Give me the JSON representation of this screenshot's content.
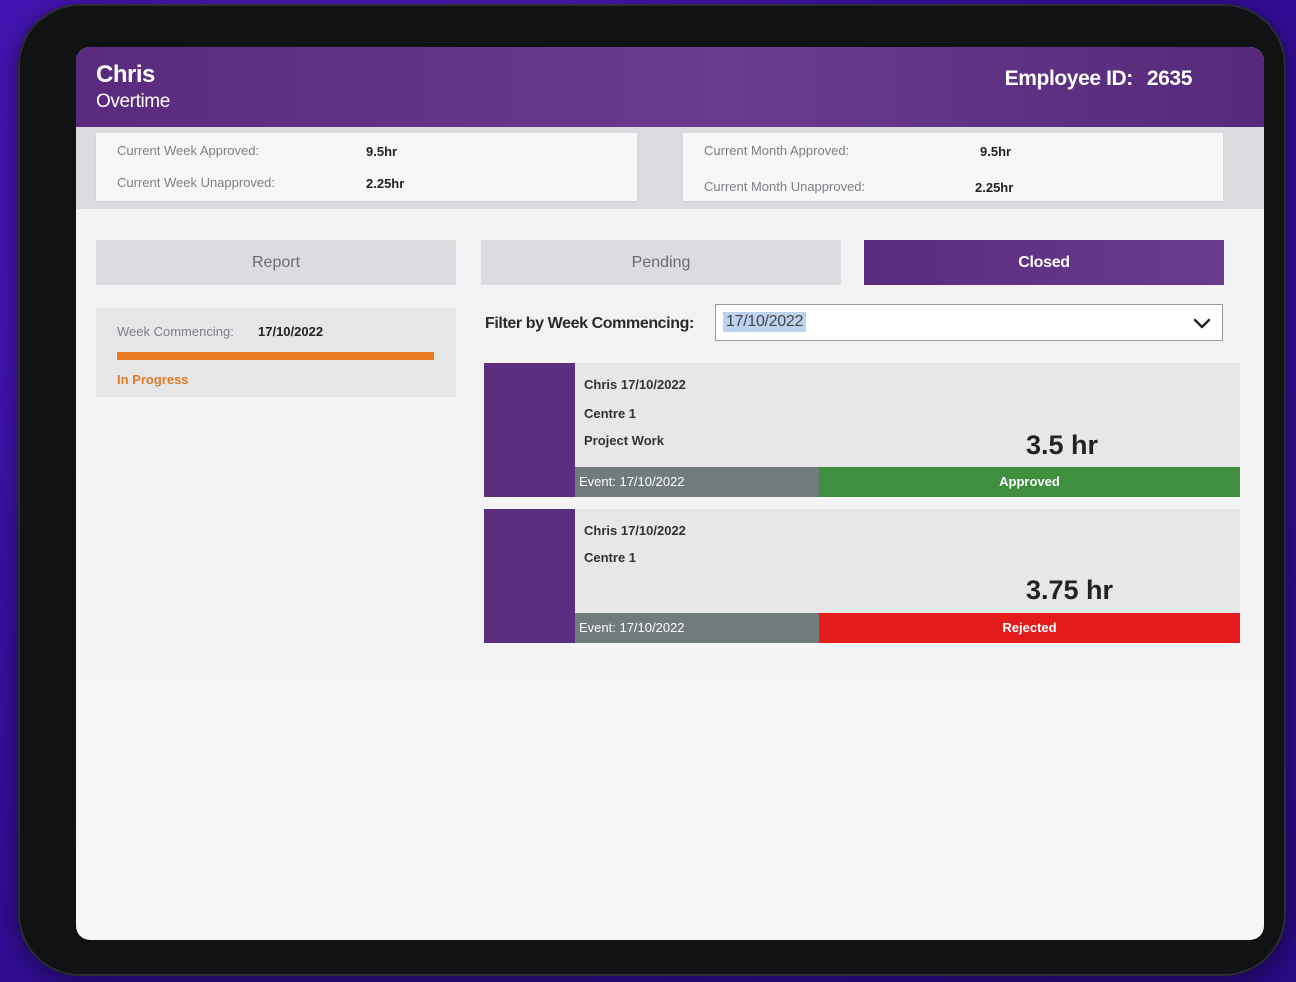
{
  "header": {
    "name": "Chris",
    "subtitle": "Overtime",
    "employee_label": "Employee ID:",
    "employee_id": "2635"
  },
  "summary": {
    "week": {
      "approved_label": "Current Week Approved:",
      "approved": "9.5hr",
      "unapproved_label": "Current Week Unapproved:",
      "unapproved": "2.25hr"
    },
    "month": {
      "approved_label": "Current Month Approved:",
      "approved": "9.5hr",
      "unapproved_label": "Current Month Unapproved:",
      "unapproved": "2.25hr"
    }
  },
  "tabs": [
    {
      "label": "Report"
    },
    {
      "label": "Pending"
    },
    {
      "label": "Closed",
      "active": true
    }
  ],
  "week_card": {
    "label": "Week Commencing:",
    "value": "17/10/2022",
    "progress": 1.0,
    "status": "In Progress",
    "status_color": "#e97a24"
  },
  "filter": {
    "label": "Filter by Week Commencing:",
    "value": "17/10/2022",
    "icon": "chevron-down-icon"
  },
  "entries": [
    {
      "title": "Chris 17/10/2022",
      "centre": "Centre 1",
      "description": "Project Work",
      "hours": "3.5 hr",
      "event": "Event: 17/10/2022",
      "status": "Approved",
      "status_color": "#3f8f3f"
    },
    {
      "title": "Chris 17/10/2022",
      "centre": "Centre 1",
      "hours": "3.75 hr",
      "event": "Event: 17/10/2022",
      "status": "Rejected",
      "status_color": "#e51a1a"
    }
  ],
  "colors": {
    "brand": "#5b2e7f",
    "approved": "#3f8f3f",
    "rejected": "#e51a1a",
    "progress": "#e97a24"
  }
}
